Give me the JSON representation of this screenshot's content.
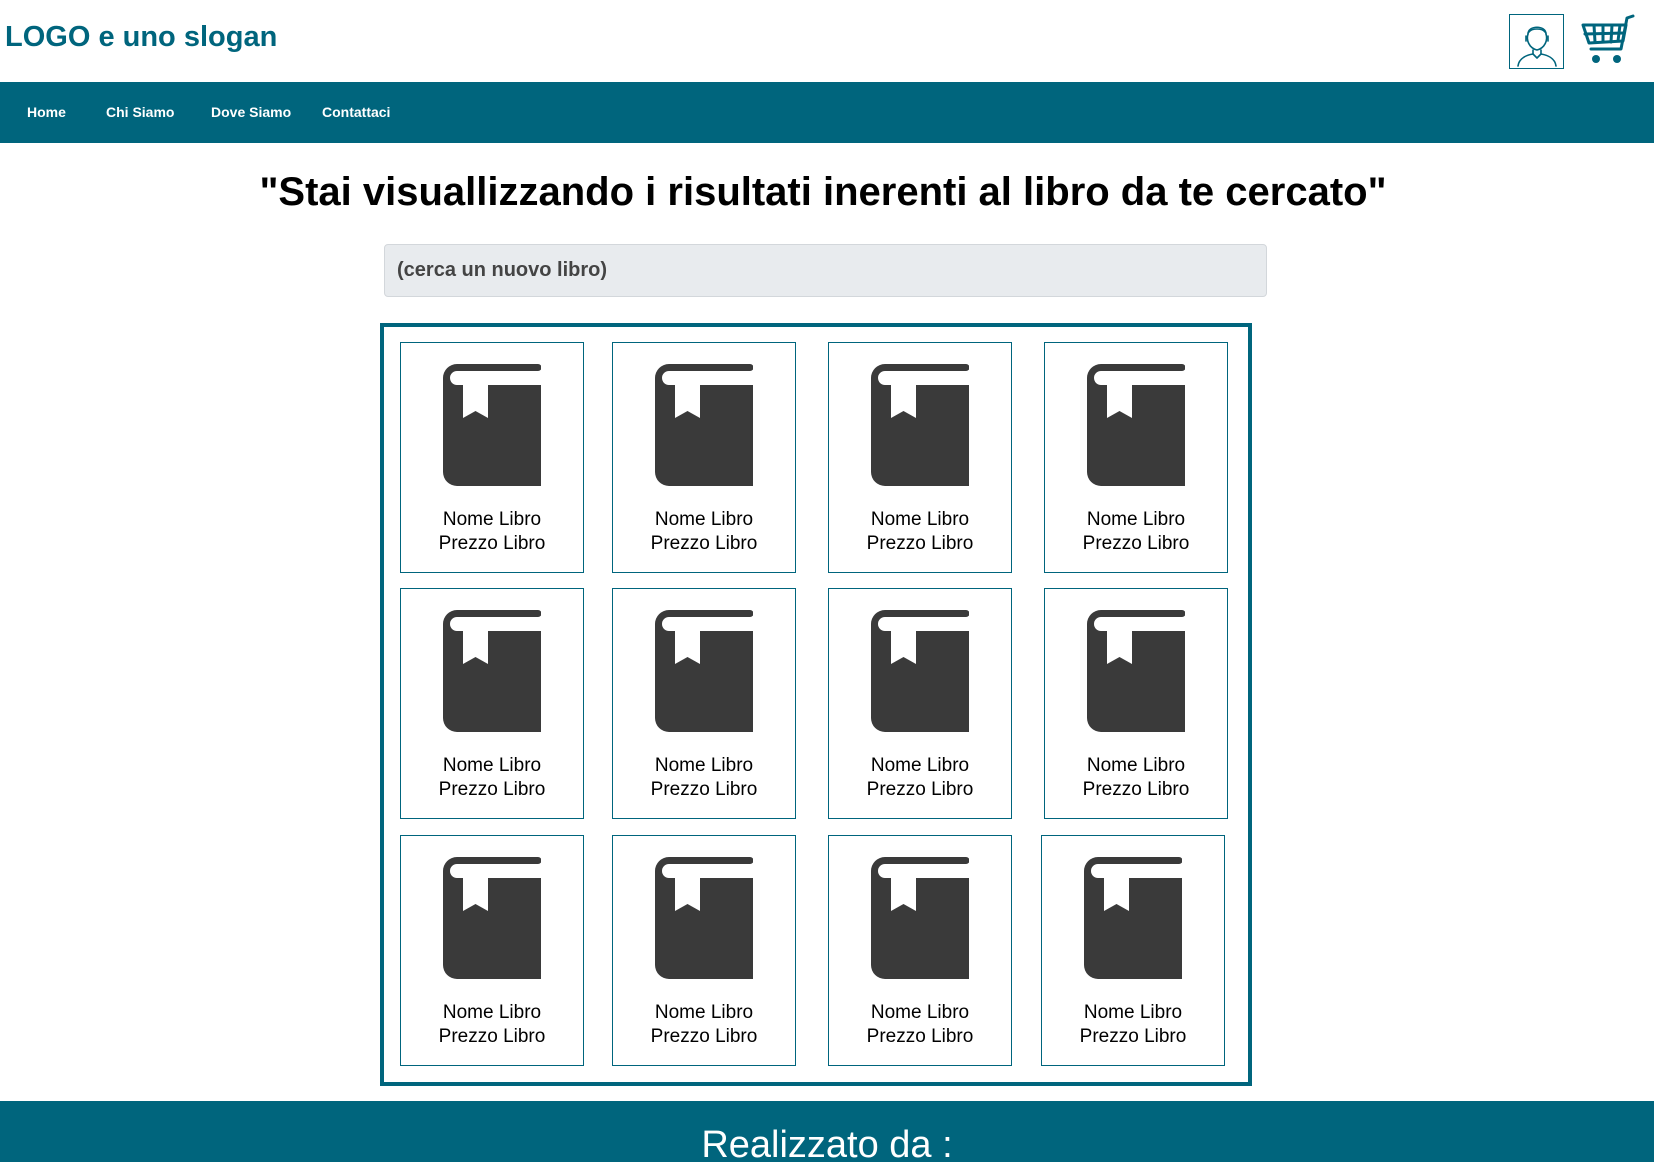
{
  "header": {
    "logo_text": "LOGO e uno slogan",
    "user_icon": "user-avatar-icon",
    "cart_icon": "shopping-cart-icon"
  },
  "nav": {
    "items": [
      {
        "label": "Home"
      },
      {
        "label": "Chi Siamo"
      },
      {
        "label": "Dove Siamo"
      },
      {
        "label": "Contattaci"
      }
    ]
  },
  "main": {
    "title": "\"Stai visuallizzando i risultati inerenti al libro da te cercato\"",
    "search": {
      "value": "",
      "placeholder": "(cerca un nuovo libro)"
    },
    "book_icon": "book-bookmark-icon",
    "books": [
      {
        "name": "Nome Libro",
        "price": "Prezzo Libro"
      },
      {
        "name": "Nome Libro",
        "price": "Prezzo Libro"
      },
      {
        "name": "Nome Libro",
        "price": "Prezzo Libro"
      },
      {
        "name": "Nome Libro",
        "price": "Prezzo Libro"
      },
      {
        "name": "Nome Libro",
        "price": "Prezzo Libro"
      },
      {
        "name": "Nome Libro",
        "price": "Prezzo Libro"
      },
      {
        "name": "Nome Libro",
        "price": "Prezzo Libro"
      },
      {
        "name": "Nome Libro",
        "price": "Prezzo Libro"
      },
      {
        "name": "Nome Libro",
        "price": "Prezzo Libro"
      },
      {
        "name": "Nome Libro",
        "price": "Prezzo Libro"
      },
      {
        "name": "Nome Libro",
        "price": "Prezzo Libro"
      },
      {
        "name": "Nome Libro",
        "price": "Prezzo Libro"
      }
    ]
  },
  "footer": {
    "text": "Realizzato da :"
  },
  "colors": {
    "brand": "#00657d",
    "search_bg": "#e8ebee",
    "book_icon": "#3a3a3a"
  }
}
